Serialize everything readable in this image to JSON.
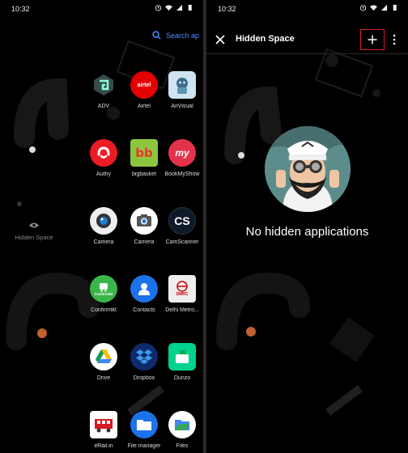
{
  "status": {
    "time": "10:32"
  },
  "drawer": {
    "search_label": "Search ap",
    "hidden_space_label": "Hidden Space",
    "apps": [
      {
        "label": "ADV",
        "icon": "adv-icon"
      },
      {
        "label": "Airtel",
        "icon": "airtel-icon",
        "badge": "airtel"
      },
      {
        "label": "AirVisual",
        "icon": "airvisual-icon"
      },
      {
        "label": "Authy",
        "icon": "authy-icon"
      },
      {
        "label": "bigbasket",
        "icon": "bigbasket-icon",
        "badge": "bb"
      },
      {
        "label": "BookMyShow",
        "icon": "bookmyshow-icon",
        "badge": "my"
      },
      {
        "label": "Camera",
        "icon": "camera-icon"
      },
      {
        "label": "Camera",
        "icon": "camera-icon"
      },
      {
        "label": "CamScanner",
        "icon": "camscanner-icon",
        "badge": "CS"
      },
      {
        "label": "Confirmtkt",
        "icon": "confirmtkt-icon",
        "badge": "Confirmtkt"
      },
      {
        "label": "Contacts",
        "icon": "contacts-icon"
      },
      {
        "label": "Delhi Metro...",
        "icon": "delhi-metro-icon",
        "badge": "DMRC"
      },
      {
        "label": "Drive",
        "icon": "drive-icon"
      },
      {
        "label": "Dropbox",
        "icon": "dropbox-icon"
      },
      {
        "label": "Dunzo",
        "icon": "dunzo-icon"
      },
      {
        "label": "eRail.in",
        "icon": "erail-icon"
      },
      {
        "label": "File manager",
        "icon": "file-manager-icon"
      },
      {
        "label": "Files",
        "icon": "files-icon"
      }
    ]
  },
  "hidden_space": {
    "title": "Hidden Space",
    "empty_message": "No hidden applications"
  },
  "colors": {
    "accent": "#4f8cff",
    "highlight_box": "#d52020"
  }
}
